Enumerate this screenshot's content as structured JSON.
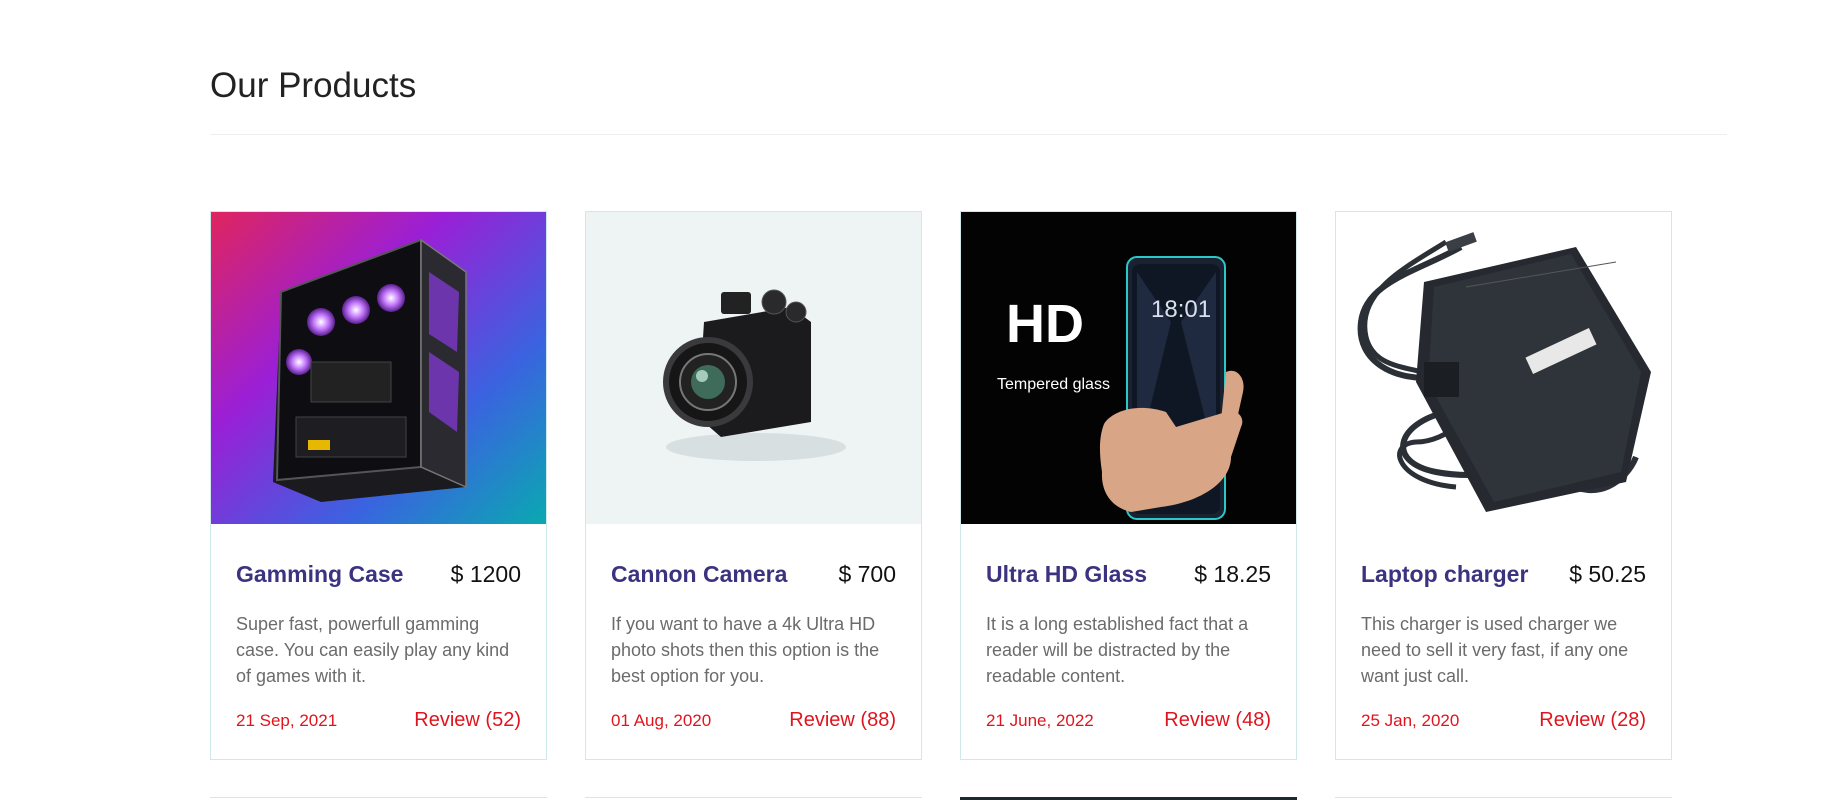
{
  "section": {
    "title": "Our Products"
  },
  "products": [
    {
      "name": "Gamming Case",
      "price": "$ 1200",
      "description": "Super fast, powerfull gamming case. You can easily play any kind of games with it.",
      "date": "21 Sep, 2021",
      "review": "Review (52)",
      "image": "pc-case-image"
    },
    {
      "name": "Cannon Camera",
      "price": "$ 700",
      "description": "If you want to have a 4k Ultra HD photo shots then this option is the best option for you.",
      "date": "01 Aug, 2020",
      "review": "Review (88)",
      "image": "camera-image"
    },
    {
      "name": "Ultra HD Glass",
      "price": "$ 18.25",
      "description": "It is a long established fact that a reader will be distracted by the readable content.",
      "date": "21 June, 2022",
      "review": "Review (48)",
      "image": "screen-protector-image",
      "image_text": {
        "hd": "HD",
        "tempered": "Tempered glass",
        "clock": "18:01"
      }
    },
    {
      "name": "Laptop charger",
      "price": "$ 50.25",
      "description": "This charger is used charger we need to sell it very fast, if any one want just call.",
      "date": "25 Jan, 2020",
      "review": "Review (28)",
      "image": "laptop-charger-image"
    }
  ],
  "colors": {
    "name": "#3c3380",
    "accent": "#e0141e",
    "border": "#cfe8ea"
  }
}
